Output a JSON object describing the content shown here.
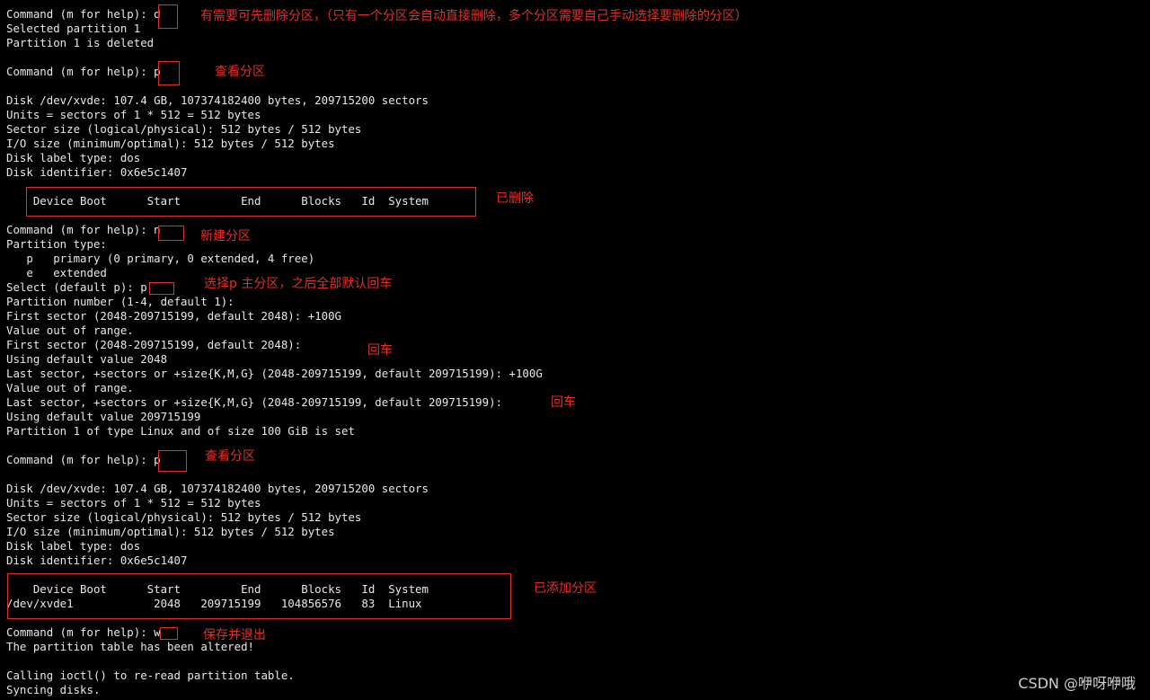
{
  "terminal": {
    "lines": [
      "Command (m for help): d",
      "Selected partition 1",
      "Partition 1 is deleted",
      "",
      "Command (m for help): p",
      "",
      "Disk /dev/xvde: 107.4 GB, 107374182400 bytes, 209715200 sectors",
      "Units = sectors of 1 * 512 = 512 bytes",
      "Sector size (logical/physical): 512 bytes / 512 bytes",
      "I/O size (minimum/optimal): 512 bytes / 512 bytes",
      "Disk label type: dos",
      "Disk identifier: 0x6e5c1407",
      "",
      "    Device Boot      Start         End      Blocks   Id  System",
      "",
      "Command (m for help): n",
      "Partition type:",
      "   p   primary (0 primary, 0 extended, 4 free)",
      "   e   extended",
      "Select (default p): p",
      "Partition number (1-4, default 1):",
      "First sector (2048-209715199, default 2048): +100G",
      "Value out of range.",
      "First sector (2048-209715199, default 2048):",
      "Using default value 2048",
      "Last sector, +sectors or +size{K,M,G} (2048-209715199, default 209715199): +100G",
      "Value out of range.",
      "Last sector, +sectors or +size{K,M,G} (2048-209715199, default 209715199):",
      "Using default value 209715199",
      "Partition 1 of type Linux and of size 100 GiB is set",
      "",
      "Command (m for help): p",
      "",
      "Disk /dev/xvde: 107.4 GB, 107374182400 bytes, 209715200 sectors",
      "Units = sectors of 1 * 512 = 512 bytes",
      "Sector size (logical/physical): 512 bytes / 512 bytes",
      "I/O size (minimum/optimal): 512 bytes / 512 bytes",
      "Disk label type: dos",
      "Disk identifier: 0x6e5c1407",
      "",
      "    Device Boot      Start         End      Blocks   Id  System",
      "/dev/xvde1            2048   209715199   104856576   83  Linux",
      "",
      "Command (m for help): w",
      "The partition table has been altered!",
      "",
      "Calling ioctl() to re-read partition table.",
      "Syncing disks."
    ]
  },
  "annotations": {
    "delete": "有需要可先删除分区，（只有一个分区会自动直接删除，多个分区需要自己手动选择要删除的分区）",
    "view1": "查看分区",
    "deleted": "已删除",
    "new": "新建分区",
    "select_p": "选择p 主分区，之后全部默认回车",
    "enter1": "回车",
    "enter2": "回车",
    "view2": "查看分区",
    "added": "已添加分区",
    "save": "保存并退出"
  },
  "watermark": "CSDN @咿呀咿哦",
  "colors": {
    "background": "#000000",
    "text": "#e8e8e8",
    "annotation": "#e0302a"
  }
}
